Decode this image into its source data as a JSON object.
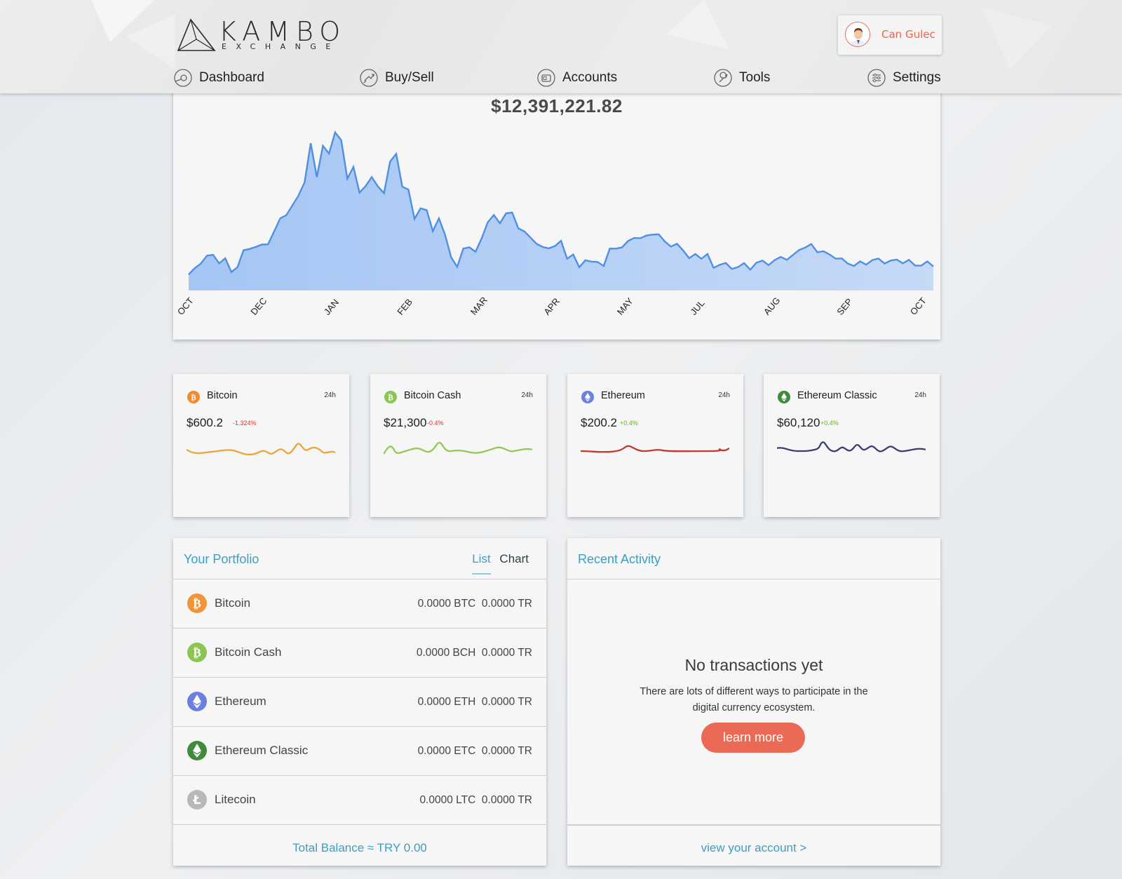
{
  "brand": {
    "name": "KAMBO",
    "sub": "EXCHANGE"
  },
  "user": {
    "name": "Can Gulec"
  },
  "nav": [
    {
      "label": "Dashboard",
      "icon": "dashboard-icon"
    },
    {
      "label": "Buy/Sell",
      "icon": "exchange-icon"
    },
    {
      "label": "Accounts",
      "icon": "wallet-icon"
    },
    {
      "label": "Tools",
      "icon": "wrench-icon"
    },
    {
      "label": "Settings",
      "icon": "sliders-icon"
    }
  ],
  "total_value": "$12,391,221.82",
  "main_chart": {
    "x_labels": [
      "OCT",
      "DEC",
      "JAN",
      "FEB",
      "MAR",
      "APR",
      "MAY",
      "JUL",
      "AUG",
      "SEP",
      "OCT"
    ],
    "line_color": "#4f90e2",
    "fill_color": "#b4cff5"
  },
  "coins": [
    {
      "name": "Bitcoin",
      "period": "24h",
      "price": "$600.2",
      "change": "-1.324%",
      "change_color": "#d9352a",
      "color": "#f0a23a",
      "icon": "bitcoin-icon"
    },
    {
      "name": "Bitcoin Cash",
      "period": "24h",
      "price": "$21,300",
      "change": "-0.4%",
      "change_color": "#d9352a",
      "color": "#94c855",
      "icon": "bitcoin-cash-icon"
    },
    {
      "name": "Ethereum",
      "period": "24h",
      "price": "$200.2",
      "change": "+0.4%",
      "change_color": "#6aac2d",
      "color": "#c03a30",
      "icon": "ethereum-icon"
    },
    {
      "name": "Ethereum Classic",
      "period": "24h",
      "price": "$60,120",
      "change": "+0.4%",
      "change_color": "#6aac2d",
      "color": "#3a3c77",
      "icon": "ethereum-classic-icon"
    }
  ],
  "portfolio": {
    "title": "Your Portfolio",
    "tabs": {
      "list": "List",
      "chart": "Chart"
    },
    "rows": [
      {
        "name": "Bitcoin",
        "amount": "0.0000 BTC  0.0000 TR",
        "color": "#f0953a",
        "icon": "bitcoin-icon"
      },
      {
        "name": "Bitcoin Cash",
        "amount": "0.0000 BCH  0.0000 TR",
        "color": "#8cc552",
        "icon": "bitcoin-cash-icon"
      },
      {
        "name": "Ethereum",
        "amount": "0.0000 ETH  0.0000 TR",
        "color": "#6a7fe0",
        "icon": "ethereum-icon"
      },
      {
        "name": "Ethereum Classic",
        "amount": "0.0000 ETC  0.0000 TR",
        "color": "#3f8a3b",
        "icon": "ethereum-classic-icon"
      },
      {
        "name": "Litecoin",
        "amount": "0.0000 LTC  0.0000 TR",
        "color": "#b8b8b8",
        "icon": "litecoin-icon"
      }
    ],
    "total": "Total Balance ≈ TRY 0.00"
  },
  "activity": {
    "title": "Recent Activity",
    "empty_title": "No transactions yet",
    "empty_desc": "There are lots of different ways to participate in the digital currency ecosystem.",
    "learn_more": "learn more",
    "view_account": "view your account  >"
  }
}
